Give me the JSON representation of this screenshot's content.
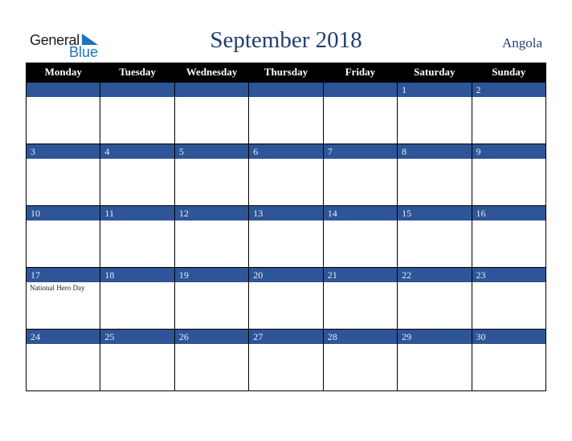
{
  "logo": {
    "general": "General",
    "blue": "Blue"
  },
  "title": "September 2018",
  "country": "Angola",
  "weekdays": [
    "Monday",
    "Tuesday",
    "Wednesday",
    "Thursday",
    "Friday",
    "Saturday",
    "Sunday"
  ],
  "weeks": [
    {
      "days": [
        "",
        "",
        "",
        "",
        "",
        "1",
        "2"
      ],
      "events": [
        "",
        "",
        "",
        "",
        "",
        "",
        ""
      ]
    },
    {
      "days": [
        "3",
        "4",
        "5",
        "6",
        "7",
        "8",
        "9"
      ],
      "events": [
        "",
        "",
        "",
        "",
        "",
        "",
        ""
      ]
    },
    {
      "days": [
        "10",
        "11",
        "12",
        "13",
        "14",
        "15",
        "16"
      ],
      "events": [
        "",
        "",
        "",
        "",
        "",
        "",
        ""
      ]
    },
    {
      "days": [
        "17",
        "18",
        "19",
        "20",
        "21",
        "22",
        "23"
      ],
      "events": [
        "National Hero Day",
        "",
        "",
        "",
        "",
        "",
        ""
      ]
    },
    {
      "days": [
        "24",
        "25",
        "26",
        "27",
        "28",
        "29",
        "30"
      ],
      "events": [
        "",
        "",
        "",
        "",
        "",
        "",
        ""
      ]
    }
  ],
  "colors": {
    "header_bg": "#000000",
    "day_bar": "#2d5597",
    "title": "#233f6e",
    "logo_blue": "#1e73be"
  }
}
